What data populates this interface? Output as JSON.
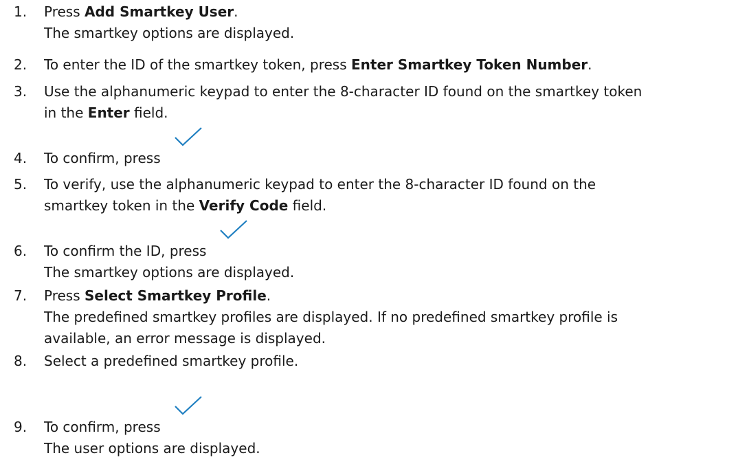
{
  "steps": [
    {
      "number": "1.",
      "pre": "Press ",
      "bold": "Add Smartkey User",
      "post": ".",
      "result": "The smartkey options are displayed."
    },
    {
      "number": "2.",
      "pre": "To enter the ID of the smartkey token, press ",
      "bold": "Enter Smartkey Token Number",
      "post": "."
    },
    {
      "number": "3.",
      "line1": "Use the alphanumeric keypad to enter the 8-character ID found on the smartkey token",
      "pre": "in the ",
      "bold": "Enter",
      "post": " field."
    },
    {
      "number": "4.",
      "text": "To confirm, press",
      "icon": "checkmark-icon"
    },
    {
      "number": "5.",
      "line1": "To verify, use the alphanumeric keypad to enter the 8-character ID found on the",
      "pre": "smartkey token in the ",
      "bold": "Verify Code",
      "post": " field."
    },
    {
      "number": "6.",
      "text": "To confirm the ID, press",
      "icon": "checkmark-icon",
      "result": "The smartkey options are displayed."
    },
    {
      "number": "7.",
      "pre": "Press ",
      "bold": "Select Smartkey Profile",
      "post": ".",
      "result1": "The predefined smartkey profiles are displayed. If no predefined smartkey profile is",
      "result2": "available, an error message is displayed."
    },
    {
      "number": "8.",
      "text": "Select a predefined smartkey profile."
    },
    {
      "number": "9.",
      "text": "To confirm, press",
      "icon": "checkmark-icon",
      "result": "The user options are displayed."
    }
  ],
  "colors": {
    "text": "#1a1a1a",
    "checkmark": "#1f7fc1"
  }
}
